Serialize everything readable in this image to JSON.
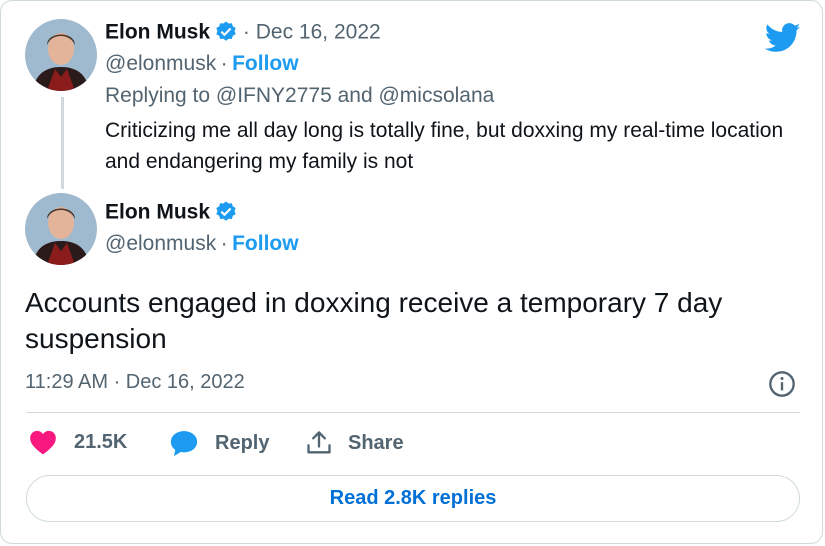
{
  "reply_tweet": {
    "author_name": "Elon Musk",
    "date": "· Dec 16, 2022",
    "handle": "@elonmusk",
    "separator": "·",
    "follow_label": "Follow",
    "replying_to": "Replying to @IFNY2775 and @micsolana",
    "text": "Criticizing me all day long is totally fine, but doxxing my real-time location and endangering my family is not"
  },
  "main_tweet": {
    "author_name": "Elon Musk",
    "handle": "@elonmusk",
    "separator": "·",
    "follow_label": "Follow",
    "text": "Accounts engaged in doxxing receive a temporary 7 day suspension",
    "timestamp": "11:29 AM · Dec 16, 2022"
  },
  "actions": {
    "like_count": "21.5K",
    "reply_label": "Reply",
    "share_label": "Share"
  },
  "read_replies_label": "Read 2.8K replies",
  "colors": {
    "brand_blue": "#1d9bf0",
    "like_pink": "#f91880",
    "text_primary": "#0f1419",
    "text_secondary": "#536471",
    "border": "#cfd9de"
  },
  "icons": [
    "twitter-bird-icon",
    "verified-badge-icon",
    "heart-icon",
    "reply-bubble-icon",
    "share-icon",
    "info-icon"
  ]
}
